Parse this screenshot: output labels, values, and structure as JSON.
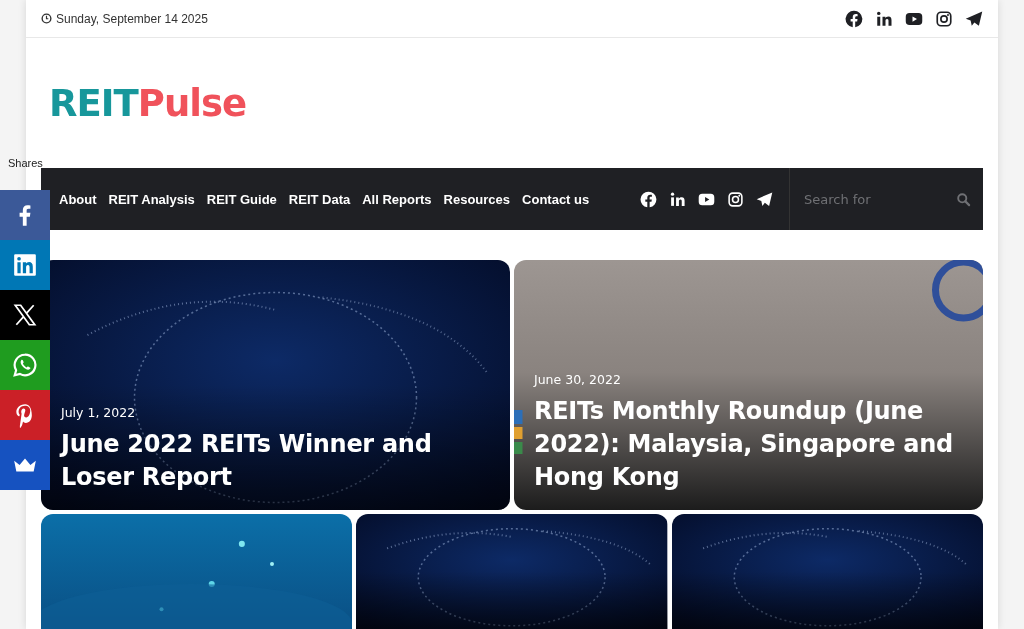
{
  "top_bar": {
    "date": "Sunday, September 14 2025"
  },
  "logo": {
    "part_1": "REIT",
    "part_2": "Pulse"
  },
  "nav": {
    "items": [
      {
        "label": "About"
      },
      {
        "label": "REIT Analysis"
      },
      {
        "label": "REIT Guide"
      },
      {
        "label": "REIT Data"
      },
      {
        "label": "All Reports"
      },
      {
        "label": "Resources"
      },
      {
        "label": "Contact us"
      }
    ],
    "search": {
      "placeholder": "Search for"
    }
  },
  "featured_posts": [
    {
      "kind": "post",
      "date": "July 1, 2022",
      "title": "June 2022 REITs Winner and Loser Report"
    },
    {
      "kind": "post",
      "date": "June 30, 2022",
      "title": "REITs Monthly Roundup (June 2022): Malaysia, Singapore and Hong Kong"
    }
  ],
  "share_bar": {
    "label": "Shares"
  }
}
